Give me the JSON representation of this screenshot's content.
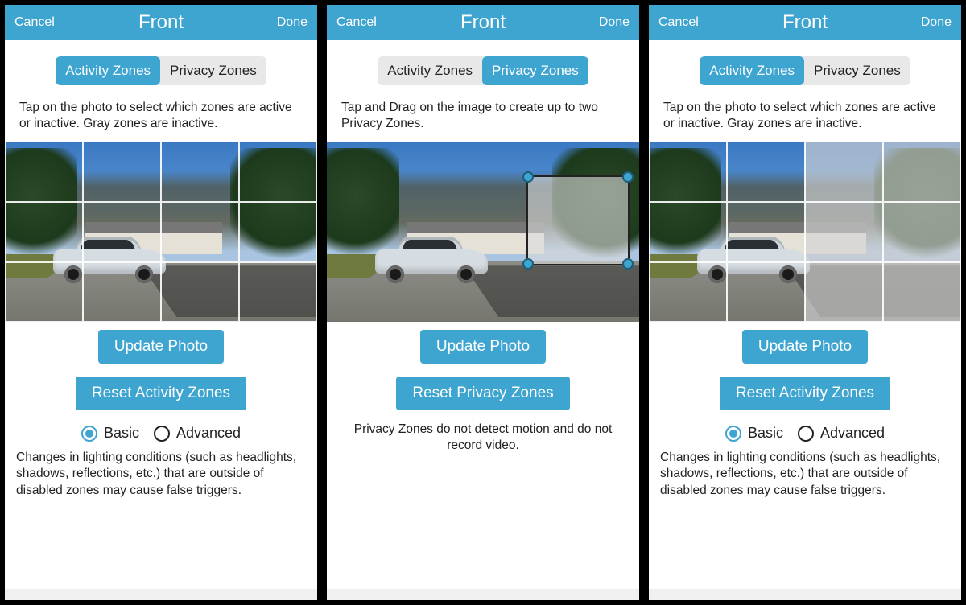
{
  "screens": {
    "a": {
      "header": {
        "cancel": "Cancel",
        "title": "Front",
        "done": "Done"
      },
      "tabs": {
        "activity": "Activity Zones",
        "privacy": "Privacy Zones",
        "active": "activity"
      },
      "instruction": "Tap on the photo to select which zones are active or inactive. Gray zones are inactive.",
      "buttons": {
        "update": "Update Photo",
        "reset": "Reset Activity Zones"
      },
      "radios": {
        "basic": "Basic",
        "advanced": "Advanced",
        "selected": "basic"
      },
      "footnote": "Changes in lighting conditions (such as headlights, shadows, reflections, etc.) that are outside of disabled zones may cause false triggers.",
      "grid": {
        "cols": 4,
        "rows": 3,
        "inactive_cells": []
      }
    },
    "b": {
      "header": {
        "cancel": "Cancel",
        "title": "Front",
        "done": "Done"
      },
      "tabs": {
        "activity": "Activity Zones",
        "privacy": "Privacy Zones",
        "active": "privacy"
      },
      "instruction": "Tap and Drag on the image to create up to two Privacy Zones.",
      "buttons": {
        "update": "Update Photo",
        "reset": "Reset Privacy Zones"
      },
      "privacy_note": "Privacy Zones do not detect motion and do not record video."
    },
    "c": {
      "header": {
        "cancel": "Cancel",
        "title": "Front",
        "done": "Done"
      },
      "tabs": {
        "activity": "Activity Zones",
        "privacy": "Privacy Zones",
        "active": "activity"
      },
      "instruction": "Tap on the photo to select which zones are active or inactive. Gray zones are inactive.",
      "buttons": {
        "update": "Update Photo",
        "reset": "Reset Activity Zones"
      },
      "radios": {
        "basic": "Basic",
        "advanced": "Advanced",
        "selected": "basic"
      },
      "footnote": "Changes in lighting conditions (such as headlights, shadows, reflections, etc.) that are outside of disabled zones may cause false triggers.",
      "grid": {
        "cols": 4,
        "rows": 3,
        "inactive_cells": [
          2,
          3,
          6,
          7,
          10,
          11
        ]
      }
    }
  }
}
